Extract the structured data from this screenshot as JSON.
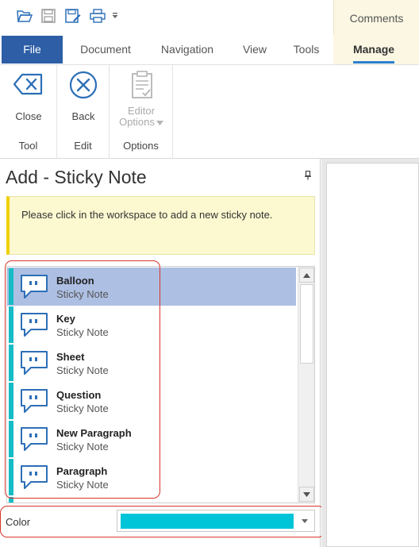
{
  "quick_access": {
    "icons": [
      "open-folder-icon",
      "save-icon",
      "save-as-icon",
      "print-icon",
      "customize-dropdown-icon"
    ]
  },
  "contextual_group": {
    "label": "Comments"
  },
  "tabs": [
    {
      "label": "File"
    },
    {
      "label": "Document"
    },
    {
      "label": "Navigation"
    },
    {
      "label": "View"
    },
    {
      "label": "Tools"
    },
    {
      "label": "Manage"
    }
  ],
  "ribbon": {
    "groups": [
      {
        "label": "Tool",
        "button": "Close"
      },
      {
        "label": "Edit",
        "button": "Back"
      },
      {
        "label": "Options",
        "button_line1": "Editor",
        "button_line2": "Options"
      }
    ]
  },
  "pane": {
    "title": "Add - Sticky Note",
    "info": "Please click in the workspace to add a new sticky note.",
    "items": [
      {
        "name": "Balloon",
        "type": "Sticky Note"
      },
      {
        "name": "Key",
        "type": "Sticky Note"
      },
      {
        "name": "Sheet",
        "type": "Sticky Note"
      },
      {
        "name": "Question",
        "type": "Sticky Note"
      },
      {
        "name": "New Paragraph",
        "type": "Sticky Note"
      },
      {
        "name": "Paragraph",
        "type": "Sticky Note"
      }
    ],
    "color_label": "Color",
    "color_value": "#00c5d8"
  },
  "colors": {
    "file_tab": "#2d5ea6",
    "item_stripe": "#16bcc6",
    "selected_row": "#adbfe3",
    "highlight": "#d9352a",
    "info_bg": "#fcf8d0"
  }
}
